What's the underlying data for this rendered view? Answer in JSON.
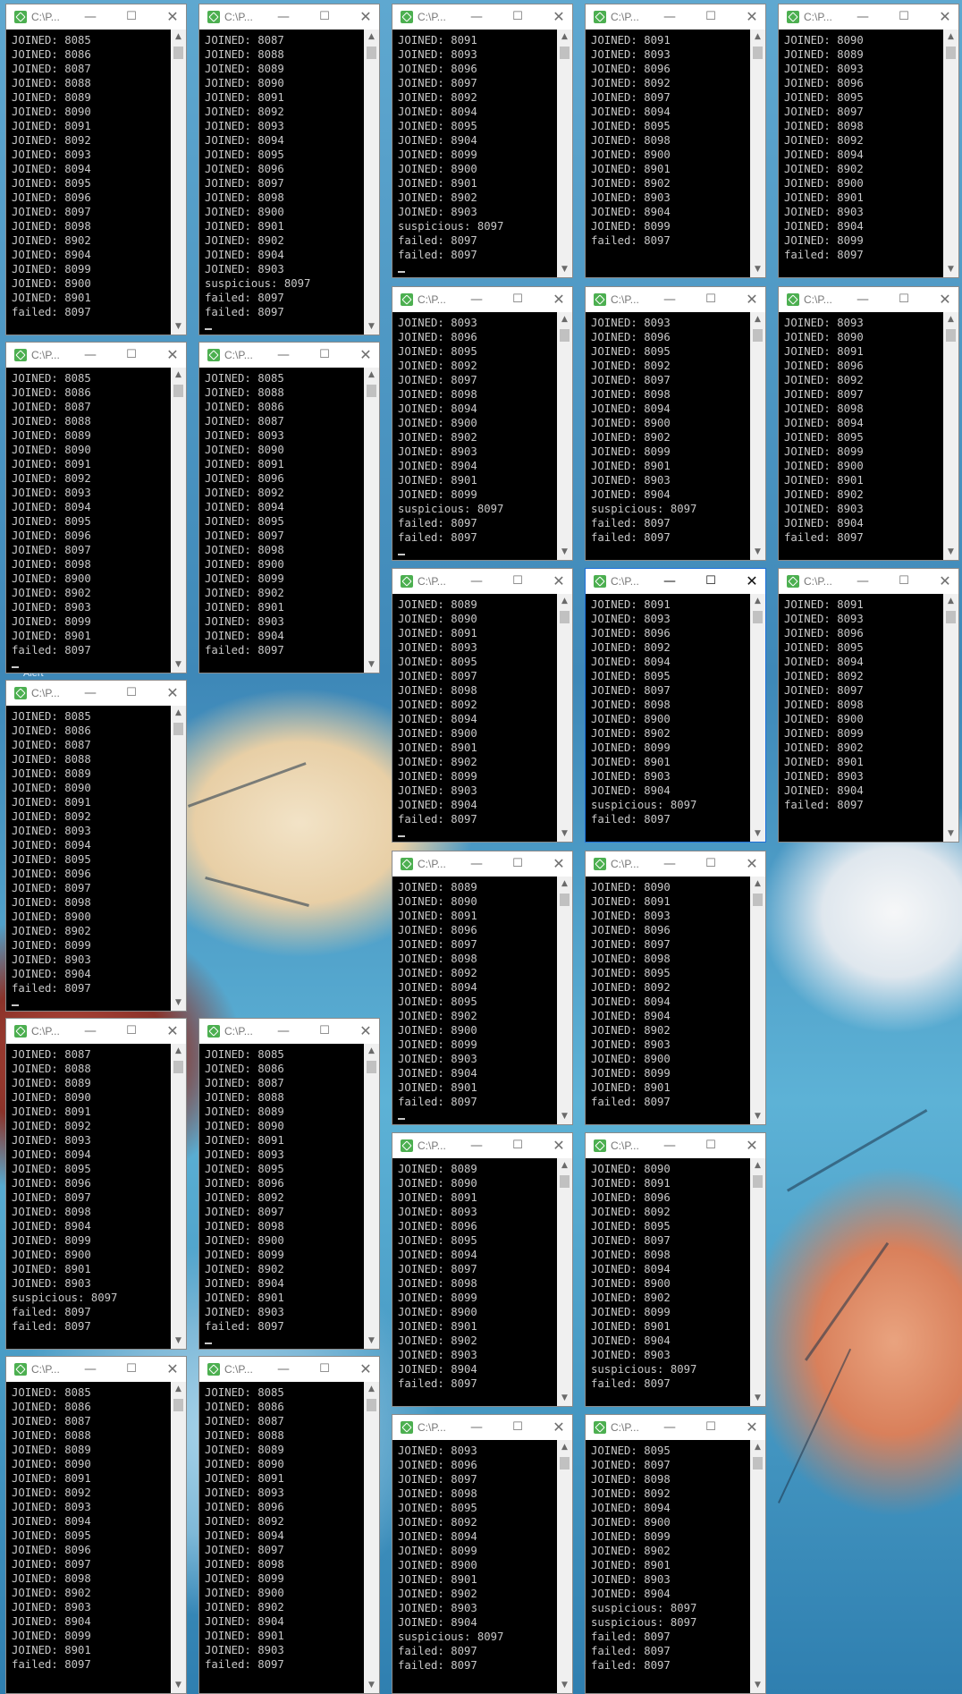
{
  "desktop": {
    "hidden_label": "Alert"
  },
  "windows": [
    {
      "title": "C:\\P...",
      "lines": [
        "JOINED: 8085",
        "JOINED: 8086",
        "JOINED: 8087",
        "JOINED: 8088",
        "JOINED: 8089",
        "JOINED: 8090",
        "JOINED: 8091",
        "JOINED: 8092",
        "JOINED: 8093",
        "JOINED: 8094",
        "JOINED: 8095",
        "JOINED: 8096",
        "JOINED: 8097",
        "JOINED: 8098",
        "JOINED: 8902",
        "JOINED: 8904",
        "JOINED: 8099",
        "JOINED: 8900",
        "JOINED: 8901",
        "failed: 8097"
      ]
    },
    {
      "title": "C:\\P...",
      "lines": [
        "JOINED: 8087",
        "JOINED: 8088",
        "JOINED: 8089",
        "JOINED: 8090",
        "JOINED: 8091",
        "JOINED: 8092",
        "JOINED: 8093",
        "JOINED: 8094",
        "JOINED: 8095",
        "JOINED: 8096",
        "JOINED: 8097",
        "JOINED: 8098",
        "JOINED: 8900",
        "JOINED: 8901",
        "JOINED: 8902",
        "JOINED: 8904",
        "JOINED: 8903",
        "suspicious: 8097",
        "failed: 8097",
        "failed: 8097"
      ]
    },
    {
      "title": "C:\\P...",
      "lines": [
        "JOINED: 8091",
        "JOINED: 8093",
        "JOINED: 8096",
        "JOINED: 8097",
        "JOINED: 8092",
        "JOINED: 8094",
        "JOINED: 8095",
        "JOINED: 8904",
        "JOINED: 8099",
        "JOINED: 8900",
        "JOINED: 8901",
        "JOINED: 8902",
        "JOINED: 8903",
        "suspicious: 8097",
        "failed: 8097",
        "failed: 8097"
      ]
    },
    {
      "title": "C:\\P...",
      "lines": [
        "JOINED: 8091",
        "JOINED: 8093",
        "JOINED: 8096",
        "JOINED: 8092",
        "JOINED: 8097",
        "JOINED: 8094",
        "JOINED: 8095",
        "JOINED: 8098",
        "JOINED: 8900",
        "JOINED: 8901",
        "JOINED: 8902",
        "JOINED: 8903",
        "JOINED: 8904",
        "JOINED: 8099",
        "failed: 8097"
      ]
    },
    {
      "title": "C:\\P...",
      "lines": [
        "JOINED: 8090",
        "JOINED: 8089",
        "JOINED: 8093",
        "JOINED: 8096",
        "JOINED: 8095",
        "JOINED: 8097",
        "JOINED: 8098",
        "JOINED: 8092",
        "JOINED: 8094",
        "JOINED: 8902",
        "JOINED: 8900",
        "JOINED: 8901",
        "JOINED: 8903",
        "JOINED: 8904",
        "JOINED: 8099",
        "failed: 8097"
      ]
    },
    {
      "title": "C:\\P...",
      "lines": [
        "JOINED: 8093",
        "JOINED: 8096",
        "JOINED: 8095",
        "JOINED: 8092",
        "JOINED: 8097",
        "JOINED: 8098",
        "JOINED: 8094",
        "JOINED: 8900",
        "JOINED: 8902",
        "JOINED: 8903",
        "JOINED: 8904",
        "JOINED: 8901",
        "JOINED: 8099",
        "suspicious: 8097",
        "failed: 8097",
        "failed: 8097"
      ]
    },
    {
      "title": "C:\\P...",
      "lines": [
        "JOINED: 8093",
        "JOINED: 8096",
        "JOINED: 8095",
        "JOINED: 8092",
        "JOINED: 8097",
        "JOINED: 8098",
        "JOINED: 8094",
        "JOINED: 8900",
        "JOINED: 8902",
        "JOINED: 8099",
        "JOINED: 8901",
        "JOINED: 8903",
        "JOINED: 8904",
        "suspicious: 8097",
        "failed: 8097",
        "failed: 8097"
      ]
    },
    {
      "title": "C:\\P...",
      "lines": [
        "JOINED: 8093",
        "JOINED: 8090",
        "JOINED: 8091",
        "JOINED: 8096",
        "JOINED: 8092",
        "JOINED: 8097",
        "JOINED: 8098",
        "JOINED: 8094",
        "JOINED: 8095",
        "JOINED: 8099",
        "JOINED: 8900",
        "JOINED: 8901",
        "JOINED: 8902",
        "JOINED: 8903",
        "JOINED: 8904",
        "failed: 8097"
      ]
    },
    {
      "title": "C:\\P...",
      "lines": [
        "JOINED: 8085",
        "JOINED: 8086",
        "JOINED: 8087",
        "JOINED: 8088",
        "JOINED: 8089",
        "JOINED: 8090",
        "JOINED: 8091",
        "JOINED: 8092",
        "JOINED: 8093",
        "JOINED: 8094",
        "JOINED: 8095",
        "JOINED: 8096",
        "JOINED: 8097",
        "JOINED: 8098",
        "JOINED: 8900",
        "JOINED: 8902",
        "JOINED: 8903",
        "JOINED: 8099",
        "JOINED: 8901",
        "failed: 8097"
      ]
    },
    {
      "title": "C:\\P...",
      "lines": [
        "JOINED: 8085",
        "JOINED: 8088",
        "JOINED: 8086",
        "JOINED: 8087",
        "JOINED: 8093",
        "JOINED: 8090",
        "JOINED: 8091",
        "JOINED: 8096",
        "JOINED: 8092",
        "JOINED: 8094",
        "JOINED: 8095",
        "JOINED: 8097",
        "JOINED: 8098",
        "JOINED: 8900",
        "JOINED: 8099",
        "JOINED: 8902",
        "JOINED: 8901",
        "JOINED: 8903",
        "JOINED: 8904",
        "failed: 8097"
      ]
    },
    {
      "title": "C:\\P...",
      "lines": [
        "JOINED: 8089",
        "JOINED: 8090",
        "JOINED: 8091",
        "JOINED: 8093",
        "JOINED: 8095",
        "JOINED: 8097",
        "JOINED: 8098",
        "JOINED: 8092",
        "JOINED: 8094",
        "JOINED: 8900",
        "JOINED: 8901",
        "JOINED: 8902",
        "JOINED: 8099",
        "JOINED: 8903",
        "JOINED: 8904",
        "failed: 8097"
      ]
    },
    {
      "title": "C:\\P...",
      "lines": [
        "JOINED: 8091",
        "JOINED: 8093",
        "JOINED: 8096",
        "JOINED: 8092",
        "JOINED: 8094",
        "JOINED: 8095",
        "JOINED: 8097",
        "JOINED: 8098",
        "JOINED: 8900",
        "JOINED: 8902",
        "JOINED: 8099",
        "JOINED: 8901",
        "JOINED: 8903",
        "JOINED: 8904",
        "suspicious: 8097",
        "failed: 8097"
      ]
    },
    {
      "title": "C:\\P...",
      "lines": [
        "JOINED: 8091",
        "JOINED: 8093",
        "JOINED: 8096",
        "JOINED: 8095",
        "JOINED: 8094",
        "JOINED: 8092",
        "JOINED: 8097",
        "JOINED: 8098",
        "JOINED: 8900",
        "JOINED: 8099",
        "JOINED: 8902",
        "JOINED: 8901",
        "JOINED: 8903",
        "JOINED: 8904",
        "failed: 8097"
      ]
    },
    {
      "title": "C:\\P...",
      "lines": [
        "JOINED: 8085",
        "JOINED: 8086",
        "JOINED: 8087",
        "JOINED: 8088",
        "JOINED: 8089",
        "JOINED: 8090",
        "JOINED: 8091",
        "JOINED: 8092",
        "JOINED: 8093",
        "JOINED: 8094",
        "JOINED: 8095",
        "JOINED: 8096",
        "JOINED: 8097",
        "JOINED: 8098",
        "JOINED: 8900",
        "JOINED: 8902",
        "JOINED: 8099",
        "JOINED: 8903",
        "JOINED: 8904",
        "failed: 8097"
      ]
    },
    {
      "title": "C:\\P...",
      "lines": [
        "JOINED: 8089",
        "JOINED: 8090",
        "JOINED: 8091",
        "JOINED: 8096",
        "JOINED: 8097",
        "JOINED: 8098",
        "JOINED: 8092",
        "JOINED: 8094",
        "JOINED: 8095",
        "JOINED: 8902",
        "JOINED: 8900",
        "JOINED: 8099",
        "JOINED: 8903",
        "JOINED: 8904",
        "JOINED: 8901",
        "failed: 8097"
      ]
    },
    {
      "title": "C:\\P...",
      "lines": [
        "JOINED: 8090",
        "JOINED: 8091",
        "JOINED: 8093",
        "JOINED: 8096",
        "JOINED: 8097",
        "JOINED: 8098",
        "JOINED: 8095",
        "JOINED: 8092",
        "JOINED: 8094",
        "JOINED: 8904",
        "JOINED: 8902",
        "JOINED: 8903",
        "JOINED: 8900",
        "JOINED: 8099",
        "JOINED: 8901",
        "failed: 8097"
      ]
    },
    {
      "title": "C:\\P...",
      "lines": [
        "JOINED: 8087",
        "JOINED: 8088",
        "JOINED: 8089",
        "JOINED: 8090",
        "JOINED: 8091",
        "JOINED: 8092",
        "JOINED: 8093",
        "JOINED: 8094",
        "JOINED: 8095",
        "JOINED: 8096",
        "JOINED: 8097",
        "JOINED: 8098",
        "JOINED: 8904",
        "JOINED: 8099",
        "JOINED: 8900",
        "JOINED: 8901",
        "JOINED: 8903",
        "suspicious: 8097",
        "failed: 8097",
        "failed: 8097"
      ]
    },
    {
      "title": "C:\\P...",
      "lines": [
        "JOINED: 8085",
        "JOINED: 8086",
        "JOINED: 8087",
        "JOINED: 8088",
        "JOINED: 8089",
        "JOINED: 8090",
        "JOINED: 8091",
        "JOINED: 8093",
        "JOINED: 8095",
        "JOINED: 8096",
        "JOINED: 8092",
        "JOINED: 8097",
        "JOINED: 8098",
        "JOINED: 8900",
        "JOINED: 8099",
        "JOINED: 8902",
        "JOINED: 8904",
        "JOINED: 8901",
        "JOINED: 8903",
        "failed: 8097"
      ]
    },
    {
      "title": "C:\\P...",
      "lines": [
        "JOINED: 8089",
        "JOINED: 8090",
        "JOINED: 8091",
        "JOINED: 8093",
        "JOINED: 8096",
        "JOINED: 8095",
        "JOINED: 8094",
        "JOINED: 8097",
        "JOINED: 8098",
        "JOINED: 8099",
        "JOINED: 8900",
        "JOINED: 8901",
        "JOINED: 8902",
        "JOINED: 8903",
        "JOINED: 8904",
        "failed: 8097"
      ]
    },
    {
      "title": "C:\\P...",
      "lines": [
        "JOINED: 8090",
        "JOINED: 8091",
        "JOINED: 8096",
        "JOINED: 8092",
        "JOINED: 8095",
        "JOINED: 8097",
        "JOINED: 8098",
        "JOINED: 8094",
        "JOINED: 8900",
        "JOINED: 8902",
        "JOINED: 8099",
        "JOINED: 8901",
        "JOINED: 8904",
        "JOINED: 8903",
        "suspicious: 8097",
        "failed: 8097"
      ]
    },
    {
      "title": "C:\\P...",
      "lines": [
        "JOINED: 8085",
        "JOINED: 8086",
        "JOINED: 8087",
        "JOINED: 8088",
        "JOINED: 8089",
        "JOINED: 8090",
        "JOINED: 8091",
        "JOINED: 8092",
        "JOINED: 8093",
        "JOINED: 8094",
        "JOINED: 8095",
        "JOINED: 8096",
        "JOINED: 8097",
        "JOINED: 8098",
        "JOINED: 8902",
        "JOINED: 8903",
        "JOINED: 8904",
        "JOINED: 8099",
        "JOINED: 8901",
        "failed: 8097"
      ]
    },
    {
      "title": "C:\\P...",
      "lines": [
        "JOINED: 8085",
        "JOINED: 8086",
        "JOINED: 8087",
        "JOINED: 8088",
        "JOINED: 8089",
        "JOINED: 8090",
        "JOINED: 8091",
        "JOINED: 8093",
        "JOINED: 8096",
        "JOINED: 8092",
        "JOINED: 8094",
        "JOINED: 8097",
        "JOINED: 8098",
        "JOINED: 8099",
        "JOINED: 8900",
        "JOINED: 8902",
        "JOINED: 8904",
        "JOINED: 8901",
        "JOINED: 8903",
        "failed: 8097"
      ]
    },
    {
      "title": "C:\\P...",
      "lines": [
        "JOINED: 8093",
        "JOINED: 8096",
        "JOINED: 8097",
        "JOINED: 8098",
        "JOINED: 8095",
        "JOINED: 8092",
        "JOINED: 8094",
        "JOINED: 8099",
        "JOINED: 8900",
        "JOINED: 8901",
        "JOINED: 8902",
        "JOINED: 8903",
        "JOINED: 8904",
        "suspicious: 8097",
        "failed: 8097",
        "failed: 8097"
      ]
    },
    {
      "title": "C:\\P...",
      "lines": [
        "JOINED: 8095",
        "JOINED: 8097",
        "JOINED: 8098",
        "JOINED: 8092",
        "JOINED: 8094",
        "JOINED: 8900",
        "JOINED: 8099",
        "JOINED: 8902",
        "JOINED: 8901",
        "JOINED: 8903",
        "JOINED: 8904",
        "suspicious: 8097",
        "suspicious: 8097",
        "failed: 8097",
        "failed: 8097",
        "failed: 8097"
      ]
    }
  ]
}
